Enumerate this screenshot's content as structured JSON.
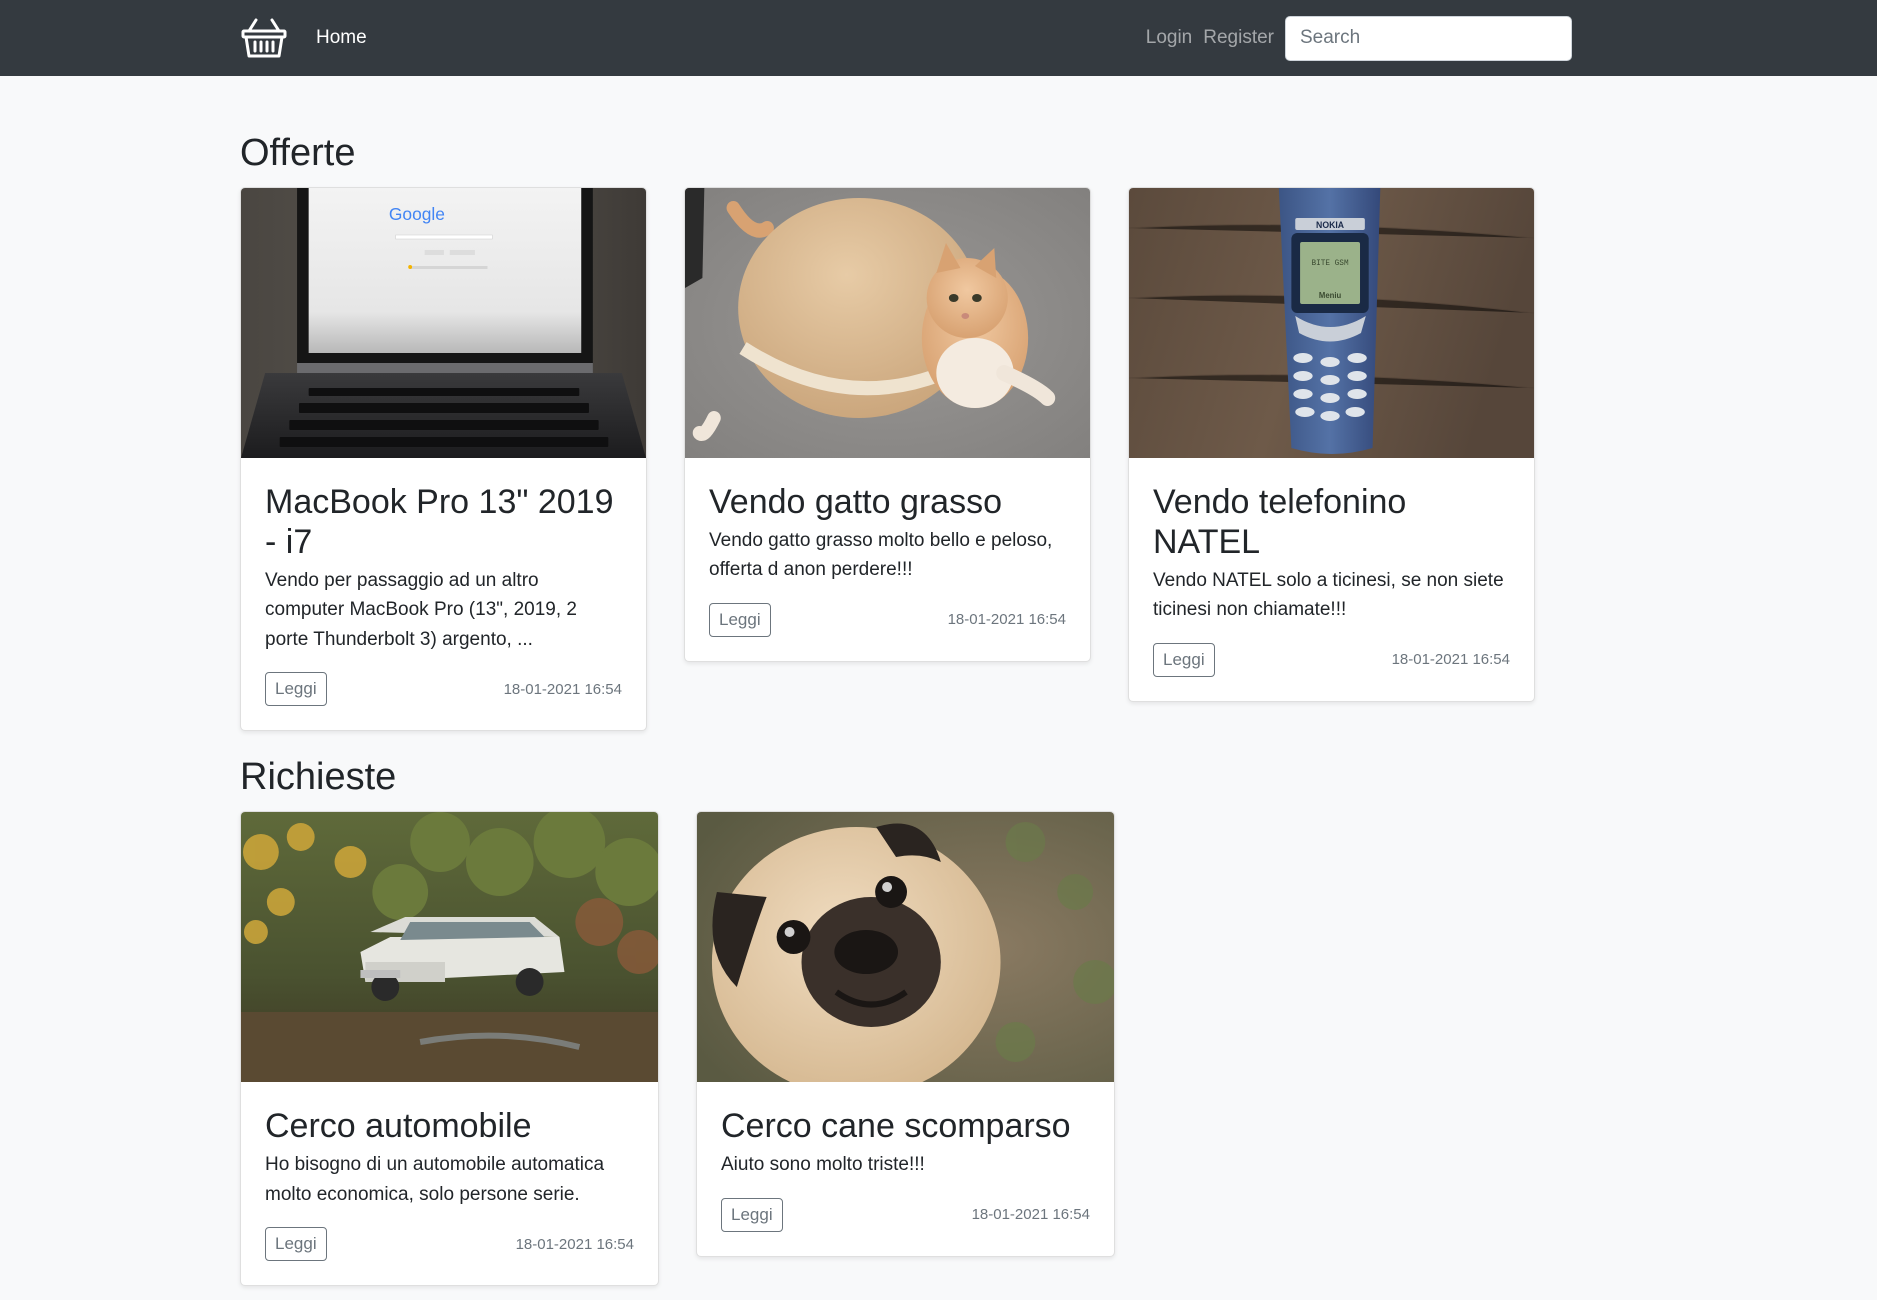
{
  "nav": {
    "home": "Home",
    "login": "Login",
    "register": "Register",
    "search_placeholder": "Search",
    "logo_icon": "shopping-basket-icon"
  },
  "offerte": {
    "title": "Offerte",
    "cards": [
      {
        "title": "MacBook Pro 13\" 2019 - i7",
        "text": "Vendo per passaggio ad un altro computer MacBook Pro (13\", 2019, 2 porte Thunderbolt 3) argento, ...",
        "button": "Leggi",
        "date": "18-01-2021 16:54",
        "image": "laptop-photo"
      },
      {
        "title": "Vendo gatto grasso",
        "text": "Vendo gatto grasso molto bello e peloso, offerta d anon perdere!!!",
        "button": "Leggi",
        "date": "18-01-2021 16:54",
        "image": "cat-photo"
      },
      {
        "title": "Vendo telefonino NATEL",
        "text": "Vendo NATEL solo a ticinesi, se non siete ticinesi non chiamate!!!",
        "button": "Leggi",
        "date": "18-01-2021 16:54",
        "image": "phone-photo",
        "phone_brand": "NOKIA",
        "phone_screen_line1": "BITE GSM",
        "phone_screen_line2": "Meniu"
      }
    ]
  },
  "richieste": {
    "title": "Richieste",
    "cards": [
      {
        "title": "Cerco automobile",
        "text": "Ho bisogno di un automobile automatica molto economica, solo persone serie.",
        "button": "Leggi",
        "date": "18-01-2021 16:54",
        "image": "car-photo"
      },
      {
        "title": "Cerco cane scomparso",
        "text": "Aiuto sono molto triste!!!",
        "button": "Leggi",
        "date": "18-01-2021 16:54",
        "image": "pug-photo"
      }
    ]
  },
  "laptop_screen_text": "Google"
}
